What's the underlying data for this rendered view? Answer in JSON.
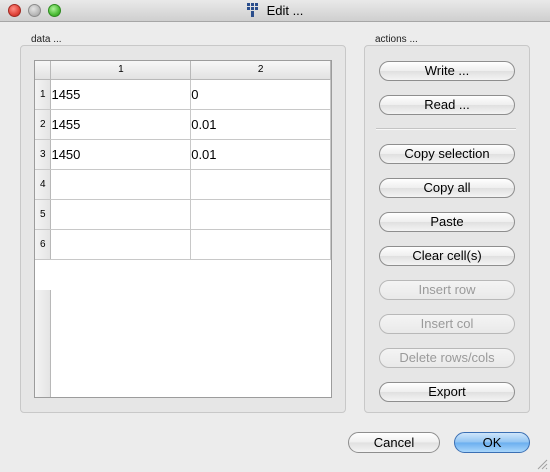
{
  "window": {
    "title": "Edit ..."
  },
  "data_panel": {
    "label": "data ...",
    "columns": [
      "1",
      "2"
    ],
    "rows": [
      {
        "index": "1",
        "c1": "1455",
        "c2": "0"
      },
      {
        "index": "2",
        "c1": "1455",
        "c2": "0.01"
      },
      {
        "index": "3",
        "c1": "1450",
        "c2": "0.01"
      },
      {
        "index": "4",
        "c1": "",
        "c2": ""
      },
      {
        "index": "5",
        "c1": "",
        "c2": ""
      },
      {
        "index": "6",
        "c1": "",
        "c2": ""
      }
    ]
  },
  "actions_panel": {
    "label": "actions ...",
    "write": "Write ...",
    "read": "Read ...",
    "copy_selection": "Copy selection",
    "copy_all": "Copy all",
    "paste": "Paste",
    "clear_cells": "Clear cell(s)",
    "insert_row": "Insert row",
    "insert_col": "Insert col",
    "delete_rows_cols": "Delete rows/cols",
    "export": "Export"
  },
  "dialog": {
    "cancel": "Cancel",
    "ok": "OK"
  }
}
